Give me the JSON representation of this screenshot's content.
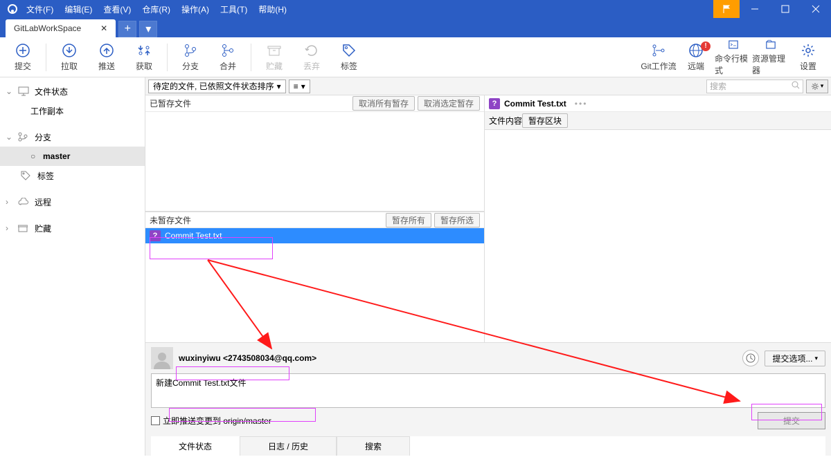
{
  "menu": {
    "file": "文件(F)",
    "edit": "编辑(E)",
    "view": "查看(V)",
    "repo": "仓库(R)",
    "actions": "操作(A)",
    "tools": "工具(T)",
    "help": "帮助(H)"
  },
  "tab": {
    "name": "GitLabWorkSpace"
  },
  "toolbar": {
    "commit": "提交",
    "pull": "拉取",
    "push": "推送",
    "fetch": "获取",
    "branch": "分支",
    "merge": "合并",
    "stash": "贮藏",
    "discard": "丢弃",
    "tag": "标签",
    "gitflow": "Git工作流",
    "remote": "远端",
    "terminal": "命令行模式",
    "explorer": "资源管理器",
    "settings": "设置"
  },
  "sidebar": {
    "file_status": "文件状态",
    "working_copy": "工作副本",
    "branches": "分支",
    "master": "master",
    "tags": "标签",
    "remotes": "远程",
    "stashes": "贮藏"
  },
  "filter": {
    "sort": "待定的文件, 已依照文件状态排序",
    "search_ph": "搜索"
  },
  "staged": {
    "title": "已暂存文件",
    "unstage_all": "取消所有暂存",
    "unstage_sel": "取消选定暂存"
  },
  "unstaged": {
    "title": "未暂存文件",
    "stage_all": "暂存所有",
    "stage_sel": "暂存所选",
    "file": "Commit Test.txt"
  },
  "preview": {
    "filename": "Commit Test.txt",
    "content_label": "文件内容",
    "stage_hunk": "暂存区块"
  },
  "commit": {
    "user": "wuxinyiwu <2743508034@qq.com>",
    "options": "提交选项...",
    "message": "新建Commit Test.txt文件",
    "push_immediately": "立即推送变更到 origin/master",
    "commit_btn": "提交"
  },
  "bottom_tabs": {
    "file_status": "文件状态",
    "log": "日志 / 历史",
    "search": "搜索"
  }
}
